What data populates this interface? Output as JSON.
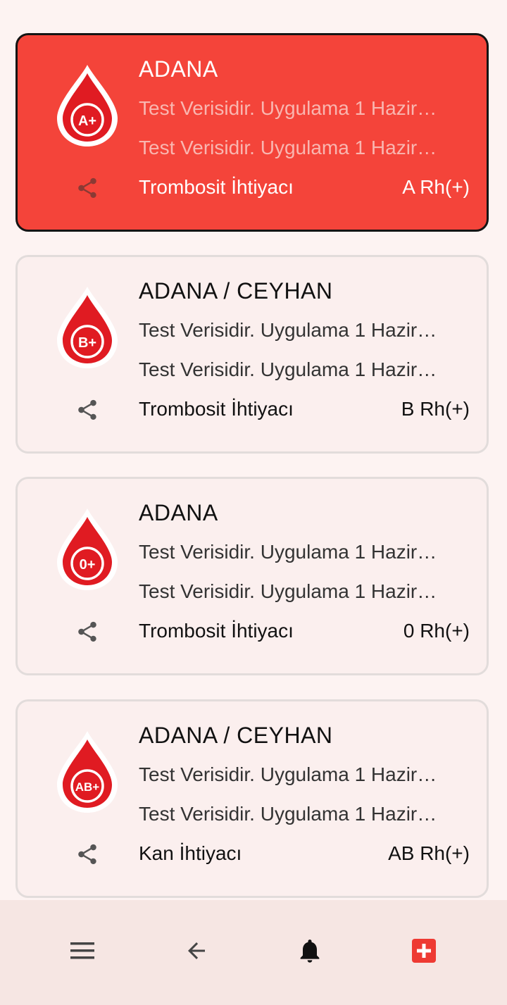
{
  "cards": [
    {
      "city": "ADANA",
      "line1": "Test Verisidir. Uygulama 1 Hazir…",
      "line2": "Test Verisidir. Uygulama 1 Hazir…",
      "need": "Trombosit İhtiyacı",
      "blood_type": "A Rh(+)",
      "drop_label": "A+",
      "selected": true
    },
    {
      "city": "ADANA / CEYHAN",
      "line1": "Test Verisidir. Uygulama 1 Hazir…",
      "line2": "Test Verisidir. Uygulama 1 Hazir…",
      "need": "Trombosit İhtiyacı",
      "blood_type": "B Rh(+)",
      "drop_label": "B+",
      "selected": false
    },
    {
      "city": "ADANA",
      "line1": "Test Verisidir. Uygulama 1 Hazir…",
      "line2": "Test Verisidir. Uygulama 1 Hazir…",
      "need": "Trombosit İhtiyacı",
      "blood_type": "0 Rh(+)",
      "drop_label": "0+",
      "selected": false
    },
    {
      "city": "ADANA / CEYHAN",
      "line1": "Test Verisidir. Uygulama 1 Hazir…",
      "line2": "Test Verisidir. Uygulama 1 Hazir…",
      "need": "Kan İhtiyacı",
      "blood_type": "AB Rh(+)",
      "drop_label": "AB+",
      "selected": false
    }
  ],
  "bottom_nav": {
    "items": [
      {
        "icon": "menu-icon"
      },
      {
        "icon": "back-arrow-icon"
      },
      {
        "icon": "bell-icon"
      },
      {
        "icon": "add-request-icon"
      }
    ]
  },
  "colors": {
    "accent": "#f4443a",
    "drop_red": "#e01b22",
    "card_bg": "#fbefee",
    "page_bg": "#fdf3f2",
    "nav_bg": "#f6e6e3"
  }
}
